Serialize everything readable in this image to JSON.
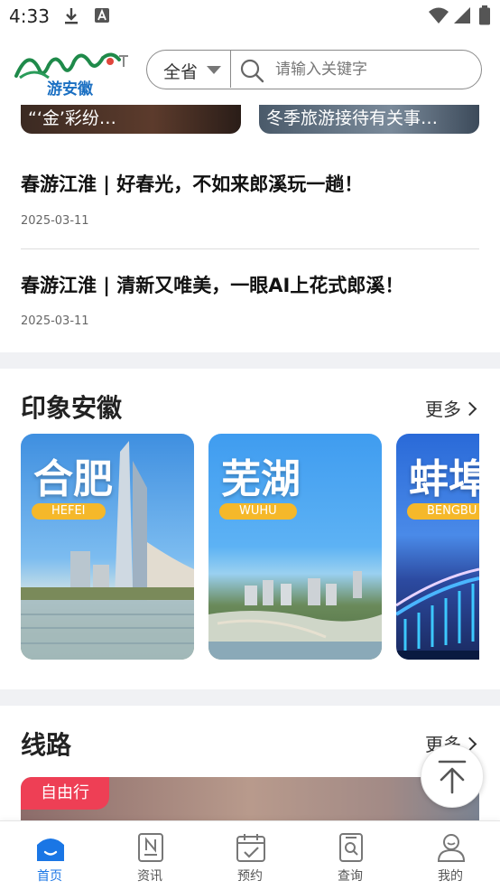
{
  "status_bar": {
    "time": "4:33"
  },
  "header": {
    "logo_text": "AnHui",
    "logo_subtext": "游安徽",
    "province_label": "全省",
    "search_placeholder": "请输入关键字"
  },
  "carousel": {
    "slides": [
      {
        "caption": "“‘金’彩纷…"
      },
      {
        "caption": "冬季旅游接待有关事…"
      }
    ]
  },
  "news": [
    {
      "title": "春游江淮 | 好春光，不如来郎溪玩一趟！",
      "date": "2025-03-11"
    },
    {
      "title": "春游江淮 | 清新又唯美，一眼AI上花式郎溪！",
      "date": "2025-03-11"
    }
  ],
  "impression": {
    "title": "印象安徽",
    "more": "更多",
    "cities": [
      {
        "name": "合肥",
        "pinyin": "HEFEI"
      },
      {
        "name": "芜湖",
        "pinyin": "WUHU"
      },
      {
        "name": "蚌埠",
        "pinyin": "BENGBU"
      }
    ]
  },
  "routes": {
    "title": "线路",
    "more": "更多",
    "first_card_tag": "自由行"
  },
  "tabbar": {
    "items": [
      {
        "label": "首页",
        "icon": "home-icon",
        "active": true
      },
      {
        "label": "资讯",
        "icon": "news-icon",
        "active": false
      },
      {
        "label": "预约",
        "icon": "calendar-check-icon",
        "active": false
      },
      {
        "label": "查询",
        "icon": "search-document-icon",
        "active": false
      },
      {
        "label": "我的",
        "icon": "user-icon",
        "active": false
      }
    ]
  },
  "colors": {
    "accent": "#1a76e5",
    "tag_red": "#ee3f55",
    "pill_yellow": "#f5b82a",
    "section_band": "#f0f1f4"
  }
}
